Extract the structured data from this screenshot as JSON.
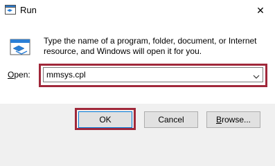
{
  "window": {
    "title": "Run",
    "close_symbol": "✕"
  },
  "dialog": {
    "description": "Type the name of a program, folder, document, or Internet resource, and Windows will open it for you.",
    "open_label_prefix": "O",
    "open_label_rest": "pen:",
    "open_value": "mmsys.cpl"
  },
  "buttons": {
    "ok": "OK",
    "cancel": "Cancel",
    "browse_prefix": "B",
    "browse_rest": "rowse..."
  },
  "colors": {
    "highlight": "#a0283a",
    "focus_border": "#0078d7",
    "run_icon_blue": "#2b7fd6"
  },
  "icons": {
    "app": "run-app-icon",
    "run": "run-dialog-icon",
    "close": "close-icon",
    "dropdown": "chevron-down-icon"
  }
}
